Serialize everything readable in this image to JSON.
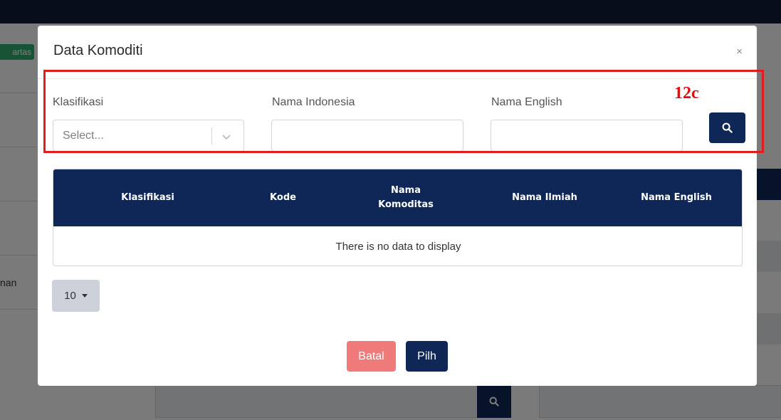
{
  "background": {
    "left_badge": "artas",
    "left_text": "nan"
  },
  "modal": {
    "title": "Data Komoditi",
    "close": "×",
    "annotation": "12c",
    "filters": {
      "klasifikasi_label": "Klasifikasi",
      "klasifikasi_placeholder": "Select...",
      "nama_indonesia_label": "Nama Indonesia",
      "nama_indonesia_value": "",
      "nama_english_label": "Nama English",
      "nama_english_value": ""
    },
    "table": {
      "columns": [
        "Klasifikasi",
        "Kode",
        "Nama Komoditas",
        "Nama Ilmiah",
        "Nama English"
      ],
      "empty_message": "There is no data to display"
    },
    "pagination": {
      "page_size": "10"
    },
    "buttons": {
      "cancel": "Batal",
      "select": "Pilh"
    }
  },
  "colors": {
    "primary": "#0f2757",
    "danger": "#f07a7a",
    "annotation": "#e01e1e",
    "badge_green": "#2ea86b"
  },
  "icons": [
    "search-icon",
    "chevron-down-icon",
    "close-icon",
    "caret-down-icon"
  ]
}
